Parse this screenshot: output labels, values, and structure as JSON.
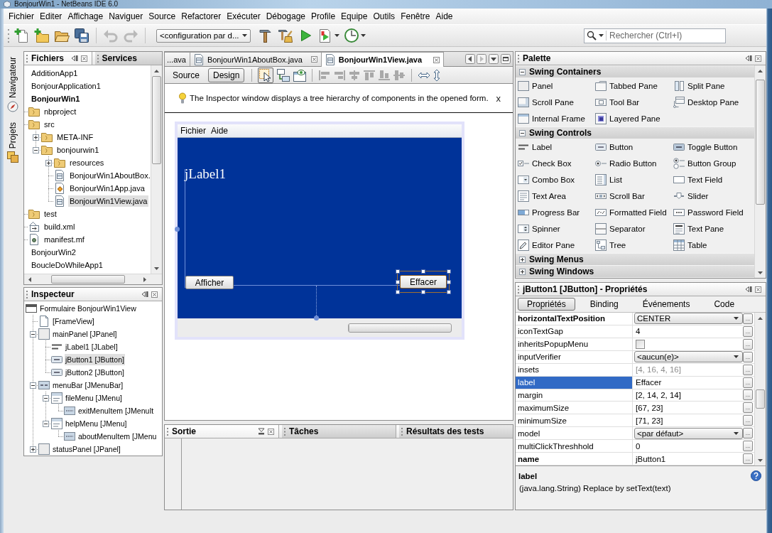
{
  "window": {
    "title": "BonjourWin1 - NetBeans IDE 6.0"
  },
  "menu_bar": [
    "Fichier",
    "Editer",
    "Affichage",
    "Naviguer",
    "Source",
    "Refactorer",
    "Exécuter",
    "Débogage",
    "Profile",
    "Equipe",
    "Outils",
    "Fenêtre",
    "Aide"
  ],
  "toolbar": {
    "undo": {
      "disabled": true
    },
    "redo": {
      "disabled": true
    },
    "configuration": "<configuration par d...",
    "search": {
      "placeholder": "Rechercher (Ctrl+I)"
    }
  },
  "side_strip": [
    "Navigateur",
    "Projets"
  ],
  "files_panel": {
    "tabs": [
      {
        "label": "Fichiers",
        "selected": true
      },
      {
        "label": "Services",
        "selected": false
      }
    ],
    "tree": [
      {
        "label": "AdditionApp1",
        "kind": "project",
        "main": false,
        "selected": false
      },
      {
        "label": "BonjourApplication1",
        "kind": "project",
        "main": false,
        "selected": false
      },
      {
        "label": "BonjourWin1",
        "kind": "project",
        "main": true,
        "selected": false,
        "children": [
          {
            "label": "nbproject",
            "kind": "folder",
            "selected": false
          },
          {
            "label": "src",
            "kind": "folder",
            "selected": false,
            "children": [
              {
                "label": "META-INF",
                "kind": "folder",
                "expanded": false,
                "selected": false
              },
              {
                "label": "bonjourwin1",
                "kind": "folder",
                "expanded": true,
                "selected": false,
                "children": [
                  {
                    "label": "resources",
                    "kind": "folder",
                    "expanded": false,
                    "selected": false
                  },
                  {
                    "label": "BonjourWin1AboutBox.",
                    "kind": "form",
                    "selected": false
                  },
                  {
                    "label": "BonjourWin1App.java",
                    "kind": "class",
                    "selected": false
                  },
                  {
                    "label": "BonjourWin1View.java",
                    "kind": "form",
                    "selected": true
                  }
                ]
              }
            ]
          },
          {
            "label": "test",
            "kind": "folder",
            "selected": false
          },
          {
            "label": "build.xml",
            "kind": "xml",
            "selected": false
          },
          {
            "label": "manifest.mf",
            "kind": "manifest",
            "selected": false
          }
        ]
      },
      {
        "label": "BonjourWin2",
        "kind": "project",
        "main": false,
        "selected": false
      },
      {
        "label": "BoucleDoWhileApp1",
        "kind": "project",
        "main": false,
        "selected": false
      }
    ]
  },
  "inspector": {
    "title": "Inspecteur",
    "tree": [
      {
        "label": "Formulaire BonjourWin1View",
        "kind": "form",
        "selected": false,
        "children": [
          {
            "label": "[FrameView]",
            "kind": "frame",
            "selected": false
          },
          {
            "label": "mainPanel [JPanel]",
            "kind": "panel",
            "expanded": true,
            "selected": false,
            "children": [
              {
                "label": "jLabel1 [JLabel]",
                "kind": "label",
                "selected": false
              },
              {
                "label": "jButton1 [JButton]",
                "kind": "button",
                "selected": true
              },
              {
                "label": "jButton2 [JButton]",
                "kind": "button",
                "selected": false
              }
            ]
          },
          {
            "label": "menuBar [JMenuBar]",
            "kind": "menubar",
            "expanded": true,
            "selected": false,
            "children": [
              {
                "label": "fileMenu [JMenu]",
                "kind": "menu",
                "expanded": true,
                "selected": false,
                "children": [
                  {
                    "label": "exitMenuItem [JMenuIt",
                    "kind": "menuitem",
                    "selected": false
                  }
                ]
              },
              {
                "label": "helpMenu [JMenu]",
                "kind": "menu",
                "expanded": true,
                "selected": false,
                "children": [
                  {
                    "label": "aboutMenuItem [JMenu",
                    "kind": "menuitem",
                    "selected": false
                  }
                ]
              }
            ]
          },
          {
            "label": "statusPanel [JPanel]",
            "kind": "panel",
            "expanded": false,
            "selected": false
          }
        ]
      }
    ]
  },
  "editor": {
    "tabs": [
      {
        "label": "...ava",
        "clipped": true,
        "selected": false
      },
      {
        "label": "BonjourWin1AboutBox.java",
        "clipped": false,
        "selected": false
      },
      {
        "label": "BonjourWin1View.java",
        "clipped": false,
        "selected": true
      }
    ],
    "views": [
      {
        "label": "Source",
        "selected": false
      },
      {
        "label": "Design",
        "selected": true
      }
    ],
    "modes": [
      {
        "selected": true
      },
      {
        "selected": false
      }
    ],
    "alignment": {
      "disabled": true
    },
    "hint": {
      "text": "The Inspector window displays a tree hierarchy of components in the opened form.",
      "close": "x"
    },
    "form": {
      "menu": [
        "Fichier",
        "Aide"
      ],
      "label": "jLabel1",
      "buttons": [
        {
          "label": "Afficher",
          "selected": false
        },
        {
          "label": "Effacer",
          "selected": true
        }
      ],
      "progress": {
        "level": 0
      }
    }
  },
  "output": {
    "tabs": [
      {
        "label": "Sortie",
        "selected": true
      },
      {
        "label": "Tâches",
        "selected": false
      },
      {
        "label": "Résultats des tests",
        "selected": false
      }
    ]
  },
  "palette": {
    "title": "Palette",
    "categories": [
      {
        "label": "Swing Containers",
        "expanded": true,
        "items": [
          "Panel",
          "Tabbed Pane",
          "Split Pane",
          "Scroll Pane",
          "Tool Bar",
          "Desktop Pane",
          "Internal Frame",
          "Layered Pane"
        ]
      },
      {
        "label": "Swing Controls",
        "expanded": true,
        "items": [
          "Label",
          "Button",
          "Toggle Button",
          "Check Box",
          "Radio Button",
          "Button Group",
          "Combo Box",
          "List",
          "Text Field",
          "Text Area",
          "Scroll Bar",
          "Slider",
          "Progress Bar",
          "Formatted Field",
          "Password Field",
          "Spinner",
          "Separator",
          "Text Pane",
          "Editor Pane",
          "Tree",
          "Table"
        ]
      },
      {
        "label": "Swing Menus",
        "expanded": false
      },
      {
        "label": "Swing Windows",
        "expanded": false
      }
    ]
  },
  "properties": {
    "title": "jButton1 [JButton] - Propriétés",
    "tabs": [
      {
        "label": "Propriétés",
        "selected": true
      },
      {
        "label": "Binding",
        "selected": false
      },
      {
        "label": "Événements",
        "selected": false
      },
      {
        "label": "Code",
        "selected": false
      }
    ],
    "rows": [
      {
        "name": "horizontalTextPosition",
        "kind": "combo",
        "value": "CENTER",
        "modified": true,
        "selected": false,
        "more": "..."
      },
      {
        "name": "iconTextGap",
        "kind": "text",
        "value": "4",
        "modified": false,
        "selected": false,
        "more": "..."
      },
      {
        "name": "inheritsPopupMenu",
        "kind": "checkbox",
        "checked": false,
        "modified": false,
        "selected": false,
        "more": "..."
      },
      {
        "name": "inputVerifier",
        "kind": "combo",
        "value": "<aucun(e)>",
        "modified": false,
        "selected": false,
        "more": "..."
      },
      {
        "name": "insets",
        "kind": "text",
        "value": "[4, 16, 4, 16]",
        "read_only": true,
        "modified": false,
        "selected": false,
        "more": "..."
      },
      {
        "name": "label",
        "kind": "text",
        "value": "Effacer",
        "modified": false,
        "selected": true,
        "more": "..."
      },
      {
        "name": "margin",
        "kind": "text",
        "value": "[2, 14, 2, 14]",
        "modified": false,
        "selected": false,
        "more": "..."
      },
      {
        "name": "maximumSize",
        "kind": "text",
        "value": "[67, 23]",
        "modified": false,
        "selected": false,
        "more": "..."
      },
      {
        "name": "minimumSize",
        "kind": "text",
        "value": "[71, 23]",
        "modified": false,
        "selected": false,
        "more": "..."
      },
      {
        "name": "model",
        "kind": "combo",
        "value": "<par défaut>",
        "modified": false,
        "selected": false,
        "more": "..."
      },
      {
        "name": "multiClickThreshhold",
        "kind": "text",
        "value": "0",
        "modified": false,
        "selected": false,
        "more": "..."
      },
      {
        "name": "name",
        "kind": "text",
        "value": "jButton1",
        "modified": true,
        "selected": false,
        "more": "..."
      }
    ],
    "description": {
      "title": "label",
      "text": "(java.lang.String) Replace by setText(text)"
    }
  }
}
